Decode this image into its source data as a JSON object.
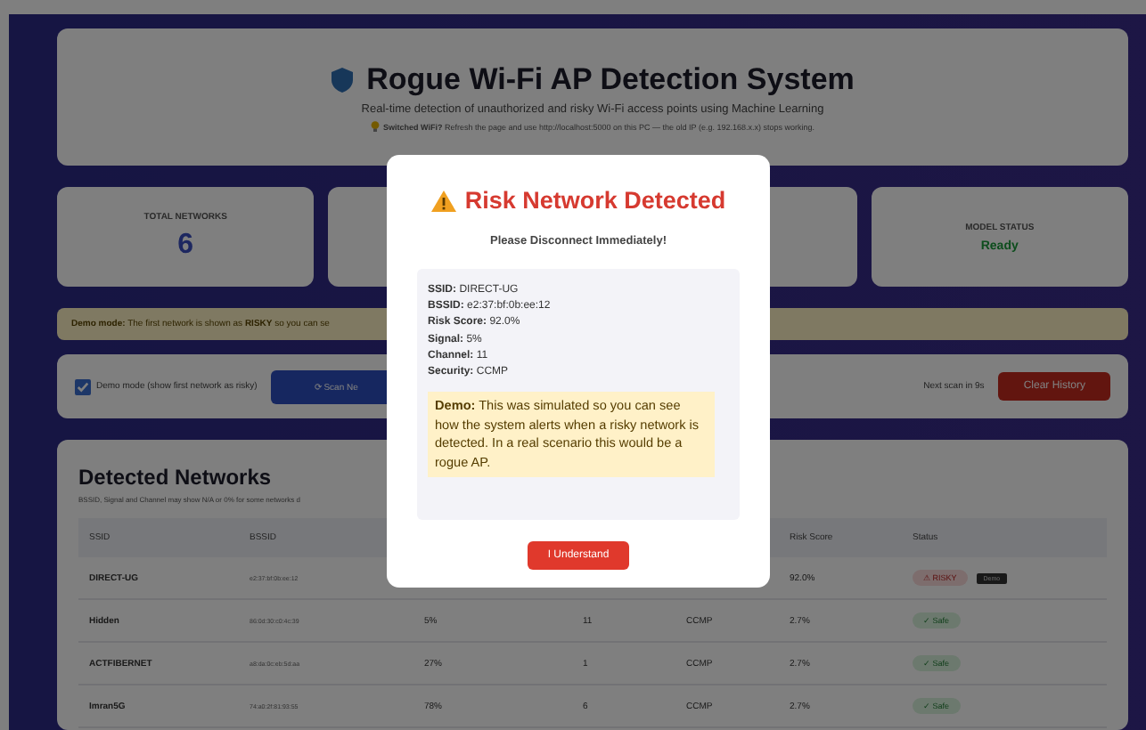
{
  "header": {
    "title": "Rogue Wi-Fi AP Detection System",
    "subtitle": "Real-time detection of unauthorized and risky Wi-Fi access points using Machine Learning",
    "note": "**Switched WiFi?** Refresh the page and use http://localhost:5000 on this PC — the old IP (e.g. 192.168.x.x) stops working."
  },
  "stats": [
    {
      "label": "TOTAL NETWORKS",
      "value": "6",
      "kind": "count"
    },
    {
      "kind": "blank"
    },
    {
      "kind": "blank"
    },
    {
      "label": "MODEL STATUS",
      "value": "Ready",
      "kind": "status"
    }
  ],
  "banner": "**Demo mode:** The first network is shown as **RISKY** so you can se",
  "controls": {
    "demo_checkbox": {
      "label": "Demo mode (show first network as risky)",
      "checked": true
    },
    "scan_button": "⟳ Scan Ne",
    "next_scan": "Next scan in 9s",
    "clear_button": "Clear History"
  },
  "networks": {
    "title": "Detected Networks",
    "note": "BSSID, Signal and Channel may show N/A or 0% for some networks d",
    "columns": [
      {
        "label": "SSID"
      },
      {
        "label": "BSSID"
      },
      {},
      {},
      {},
      {
        "label": "Risk Score"
      },
      {
        "label": "Status"
      }
    ],
    "rows": [
      {
        "ssid": "DIRECT-UG",
        "bssid": "e2:37:bf:0b:ee:12",
        "risk": "92.0%",
        "status": {
          "kind": "risky",
          "label": "⚠ RISKY"
        },
        "tag": "Demo"
      },
      {
        "ssid": "Hidden",
        "bssid": "86:0d:30:c0:4c:39",
        "signal": "5%",
        "channel": "11",
        "security": "CCMP",
        "risk": "2.7%",
        "status": {
          "kind": "safe",
          "label": "✓ Safe"
        }
      },
      {
        "ssid": "ACTFIBERNET",
        "bssid": "a8:da:0c:eb:5d:aa",
        "signal": "27%",
        "channel": "1",
        "security": "CCMP",
        "risk": "2.7%",
        "status": {
          "kind": "safe",
          "label": "✓ Safe"
        }
      },
      {
        "ssid": "Imran5G",
        "bssid": "74:a0:2f:81:93:55",
        "signal": "78%",
        "channel": "6",
        "security": "CCMP",
        "risk": "2.7%",
        "status": {
          "kind": "safe",
          "label": "✓ Safe"
        }
      }
    ]
  },
  "modal": {
    "title": "Risk Network Detected",
    "subtitle": "Please Disconnect Immediately!",
    "details": [
      {
        "label": "SSID:",
        "value": "DIRECT-UG"
      },
      {
        "label": "BSSID:",
        "value": "e2:37:bf:0b:ee:12"
      },
      {
        "label": "Risk Score:",
        "value": "92.0%"
      },
      {
        "label": "Signal:",
        "value": "5%"
      },
      {
        "label": "Channel:",
        "value": "11"
      },
      {
        "label": "Security:",
        "value": "CCMP"
      }
    ],
    "demo_note": "**Demo:** This was simulated so you can see how the system alerts when a risky network is detected. In a real scenario this would be a rogue AP.",
    "button": "I Understand"
  }
}
